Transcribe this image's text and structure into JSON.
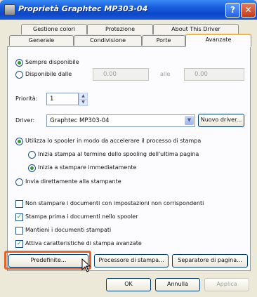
{
  "window": {
    "title": "Proprietà Graphtec MP303-04"
  },
  "titlebar": {
    "help": "?",
    "close": "✕"
  },
  "tabs": {
    "row1": [
      "Gestione colori",
      "Protezione",
      "About This Driver"
    ],
    "row2": [
      "Generale",
      "Condivisione",
      "Porte",
      "Avanzate"
    ]
  },
  "availability": {
    "always": "Sempre disponibile",
    "from": "Disponibile dalle",
    "time_from": "0.00",
    "to": "alle",
    "time_to": "0.00"
  },
  "priority": {
    "label": "Priorità:",
    "value": "1"
  },
  "driver": {
    "label": "Driver:",
    "value": "Graphtec MP303-04",
    "new_button": "Nuovo driver..."
  },
  "spool": {
    "use": "Utilizza lo spooler in modo da accelerare il processo di stampa",
    "after_last": "Inizia stampa al termine dello spooling dell'ultima pagina",
    "immediately": "Inizia a stampare immediatamente",
    "direct": "Invia direttamente alla stampante"
  },
  "options": [
    {
      "label": "Non stampare i documenti con impostazioni non corrispondenti",
      "checked": false
    },
    {
      "label": "Stampa prima i documenti nello spooler",
      "checked": true
    },
    {
      "label": "Mantieni i documenti stampati",
      "checked": false
    },
    {
      "label": "Attiva caratteristiche di stampa avanzate",
      "checked": true
    }
  ],
  "bottom_buttons": {
    "defaults": "Predefinite...",
    "processor": "Processore di stampa...",
    "separator": "Separatore di pagina..."
  },
  "dialog_buttons": {
    "ok": "OK",
    "cancel": "Annulla",
    "apply": "Applica"
  },
  "colors": {
    "highlight": "#e8622a",
    "titlebar": "#0b47c8"
  }
}
